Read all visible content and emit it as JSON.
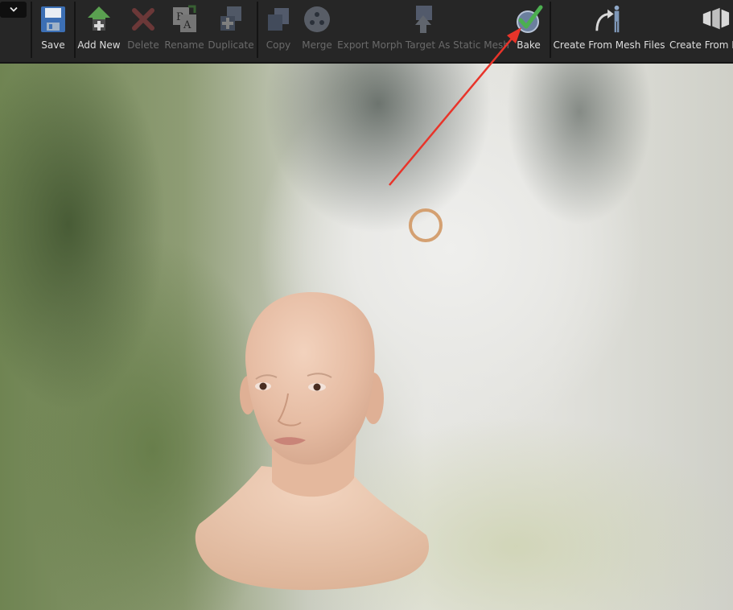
{
  "toolbar": {
    "buttons": {
      "save": "Save",
      "add_new": "Add New",
      "delete": "Delete",
      "rename": "Rename",
      "duplicate": "Duplicate",
      "copy": "Copy",
      "merge": "Merge",
      "export": "Export Morph Target As Static Mesh",
      "bake": "Bake",
      "create_from_mesh_files": "Create From Mesh Files",
      "create_from_m": "Create From M"
    },
    "disabled": [
      "delete",
      "rename",
      "duplicate",
      "copy",
      "merge",
      "export"
    ]
  },
  "colors": {
    "accent_arrow": "#e8342a",
    "marker": "#d4a071",
    "bake_check": "#4caf50"
  },
  "icons": {
    "dropdown": "chevron-down-icon",
    "save": "floppy-disk-icon",
    "add_new": "add-new-icon",
    "delete": "delete-x-icon",
    "rename": "rename-icon",
    "duplicate": "duplicate-icon",
    "copy": "copy-icon",
    "merge": "merge-icon",
    "export": "export-mesh-icon",
    "bake": "bake-check-icon",
    "create_from_mesh_files": "create-from-mesh-icon",
    "create_from_m": "create-from-icon"
  }
}
